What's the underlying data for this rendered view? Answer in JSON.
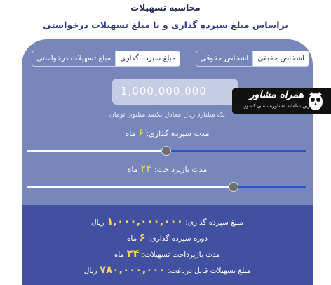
{
  "header": {
    "title": "محاسبه تسهیلات",
    "subtitle": "براساس مبلغ سپرده گذاری و یا مبلغ تسهیلات درخواستی"
  },
  "person_type": {
    "options": [
      "اشخاص حقیقی",
      "اشخاص حقوقی"
    ],
    "selected": "اشخاص حقیقی"
  },
  "calc_basis": {
    "options": [
      "مبلغ سپرده گذاری",
      "مبلغ تسهیلات درخواستی"
    ],
    "selected": "مبلغ سپرده گذاری"
  },
  "amount_input": {
    "placeholder": "1,000,000,000",
    "hint": "یک میلیارد ریال معادل یکصد میلیون تومان"
  },
  "deposit_period": {
    "label": "مدت سپرده گذاری:",
    "value": "۶",
    "unit": "ماه",
    "slider_fraction": 0.5
  },
  "repayment_period": {
    "label": "مدت بازپرداخت:",
    "value": "۲۴",
    "unit": "ماه",
    "slider_fraction": 0.74
  },
  "summary": {
    "deposit_amount_label": "مبلغ سپرده گذاری:",
    "deposit_amount_value": "۱,۰۰۰,۰۰۰,۰۰۰",
    "deposit_amount_unit": "ریال",
    "deposit_period_label": "دوره سپرده گذاری:",
    "deposit_period_value": "۶",
    "deposit_period_unit": "ماه",
    "repayment_label": "مدت بازپرداخت تسهیلات:",
    "repayment_value": "۲۴",
    "repayment_unit": "ماه",
    "loan_label": "مبلغ تسهیلات قابل دریافت:",
    "loan_value": "۷۸۰,۰۰۰,۰۰۰",
    "loan_unit": "ریال"
  },
  "watermark": {
    "name": "همراه مشاور",
    "tagline": "بزرگترین سامانه مشاوره تلفنی کشور"
  },
  "colors": {
    "card": "#7887bb",
    "panel": "#4150a0",
    "accent_number": "#f4d55a",
    "slider_active": "#2453e0"
  }
}
